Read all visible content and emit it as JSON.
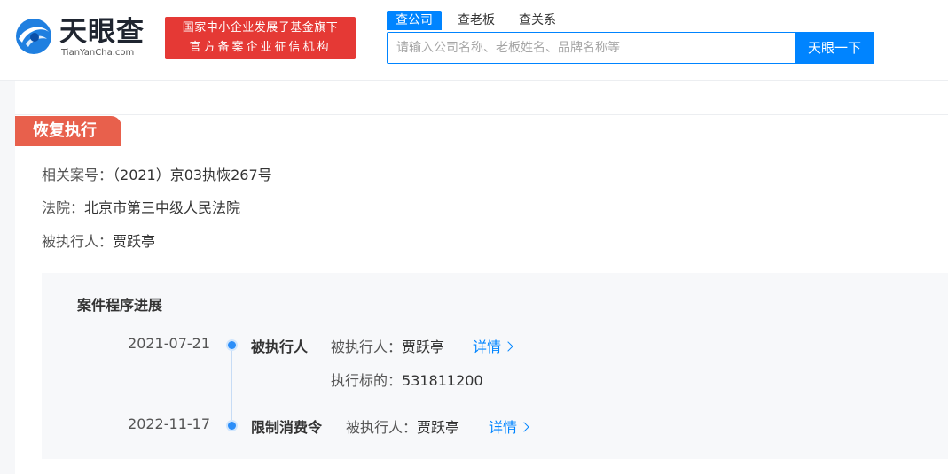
{
  "logo": {
    "name_cn": "天眼查",
    "name_en": "TianYanCha.com",
    "mark_color": "#1f7fe0"
  },
  "slogan": {
    "line1": "国家中小企业发展子基金旗下",
    "line2": "官方备案企业征信机构",
    "bg_color": "#e53935"
  },
  "search": {
    "tabs": [
      {
        "label": "查公司",
        "active": true
      },
      {
        "label": "查老板",
        "active": false
      },
      {
        "label": "查关系",
        "active": false
      }
    ],
    "placeholder": "请输入公司名称、老板姓名、品牌名称等",
    "value": "",
    "button_label": "天眼一下",
    "accent_color": "#0084ff"
  },
  "section": {
    "title": "恢复执行",
    "badge_color": "#e8604c",
    "fields": [
      {
        "label": "相关案号：",
        "value": "（2021）京03执恢267号"
      },
      {
        "label": "法院：",
        "value": "北京市第三中级人民法院"
      },
      {
        "label": "被执行人：",
        "value": "贾跃亭"
      }
    ]
  },
  "progress": {
    "title": "案件程序进展",
    "events": [
      {
        "date": "2021-07-21",
        "type": "被执行人",
        "lines": [
          {
            "label": "被执行人：",
            "value": "贾跃亭"
          },
          {
            "label": "执行标的：",
            "value": "531811200"
          }
        ],
        "link_label": "详情",
        "link_icon": "chevron-right-icon"
      },
      {
        "date": "2022-11-17",
        "type": "限制消费令",
        "lines": [
          {
            "label": "被执行人：",
            "value": "贾跃亭"
          }
        ],
        "link_label": "详情",
        "link_icon": "chevron-right-icon"
      }
    ]
  }
}
